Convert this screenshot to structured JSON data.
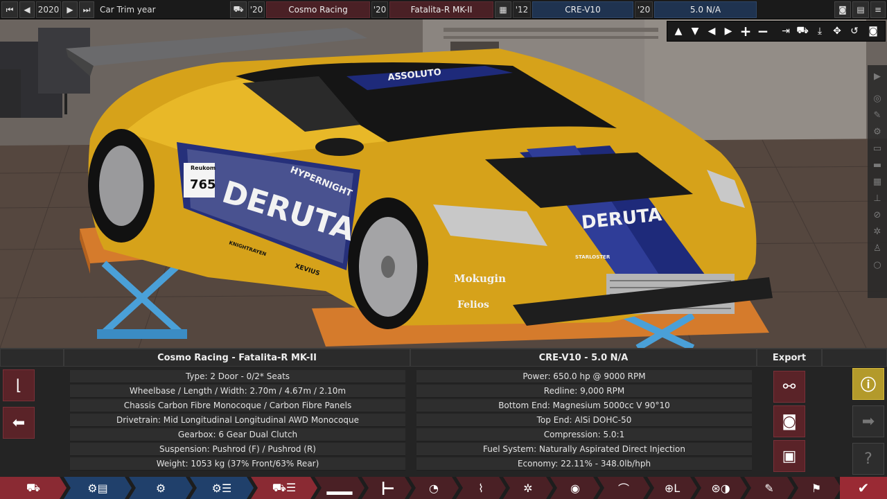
{
  "topbar": {
    "trim_year": "2020",
    "trim_label": "Car Trim year",
    "model_year": "'20",
    "company": "Cosmo Racing",
    "trim_year_short": "'20",
    "model_name": "Fatalita-R MK-II",
    "engine_family_year": "'12",
    "engine_family": "CRE-V10",
    "engine_variant_year": "'20",
    "engine_variant": "5.0 N/A"
  },
  "car": {
    "race_number": "765",
    "livery_text": "DERUTA",
    "hood_text": "DERUTA",
    "side_sponsor": "HYPERNIGHT",
    "windshield_banner": "ASSOLUTO",
    "sponsor_1": "Mokugin",
    "sponsor_2": "Felios",
    "sponsor_3": "STARLOSTER",
    "sponsor_4": "XEVIUS",
    "sponsor_5": "KNIGHTRAYEN",
    "door_tag": "Reukom"
  },
  "car_panel": {
    "title": "Cosmo Racing - Fatalita-R MK-II",
    "rows": [
      "Type: 2 Door - 0/2* Seats",
      "Wheelbase / Length / Width: 2.70m / 4.67m / 2.10m",
      "Chassis Carbon Fibre Monocoque / Carbon Fibre Panels",
      "Drivetrain: Mid Longitudinal Longitudinal AWD Monocoque",
      "Gearbox: 6 Gear Dual Clutch",
      "Suspension: Pushrod (F) / Pushrod (R)",
      "Weight: 1053 kg (37% Front/63% Rear)"
    ]
  },
  "engine_panel": {
    "title": "CRE-V10 - 5.0 N/A",
    "rows": [
      "Power: 650.0 hp @ 9000 RPM",
      "Redline:  9,000 RPM",
      "Bottom End: Magnesium 5000cc V 90°10",
      "Top End: AlSi DOHC-50",
      "Compression: 5.0:1",
      "Fuel System: Naturally Aspirated Direct Injection",
      "Economy: 22.11% - 348.0lb/hph"
    ]
  },
  "export": {
    "title": "Export"
  },
  "colors": {
    "accent_red": "#8a2a33",
    "nav_blue": "#20406b",
    "warning_gold": "#b39a2b",
    "engine_navy": "#1f3350"
  }
}
